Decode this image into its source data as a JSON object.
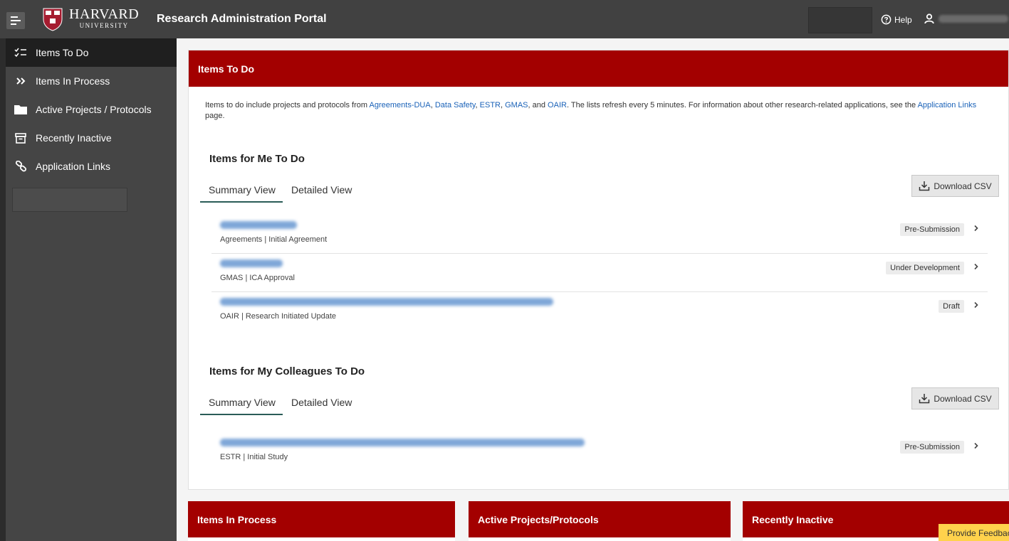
{
  "header": {
    "brand_name": "HARVARD",
    "brand_sub": "UNIVERSITY",
    "portal_title": "Research Administration Portal",
    "help_label": "Help"
  },
  "sidebar": {
    "items": [
      {
        "label": "Items To Do",
        "icon": "checklist-icon"
      },
      {
        "label": "Items In Process",
        "icon": "double-chevron-icon"
      },
      {
        "label": "Active Projects / Protocols",
        "icon": "folder-icon"
      },
      {
        "label": "Recently Inactive",
        "icon": "archive-icon"
      },
      {
        "label": "Application Links",
        "icon": "link-icon"
      }
    ]
  },
  "main": {
    "card_title": "Items To Do",
    "intro": {
      "p1": "Items to do include projects and protocols from ",
      "l1": "Agreements-DUA",
      "s1": ", ",
      "l2": "Data Safety",
      "s2": ", ",
      "l3": "ESTR",
      "s3": ", ",
      "l4": "GMAS",
      "s4": ", and ",
      "l5": "OAIR",
      "p2": ". The lists refresh every 5 minutes. For information about other research-related applications, see the ",
      "l6": "Application Links",
      "p3": " page."
    },
    "me": {
      "title": "Items for Me To Do",
      "tab_summary": "Summary View",
      "tab_detailed": "Detailed View",
      "download": "Download CSV",
      "rows": [
        {
          "meta": "Agreements | Initial Agreement",
          "status": "Pre-Submission"
        },
        {
          "meta": "GMAS | ICA Approval",
          "status": "Under Development"
        },
        {
          "meta": "OAIR | Research Initiated Update",
          "status": "Draft"
        }
      ]
    },
    "colleagues": {
      "title": "Items for My Colleagues To Do",
      "tab_summary": "Summary View",
      "tab_detailed": "Detailed View",
      "download": "Download CSV",
      "rows": [
        {
          "meta": "ESTR | Initial Study",
          "status": "Pre-Submission"
        }
      ]
    }
  },
  "bottom_cards": {
    "in_process": "Items In Process",
    "active": "Active Projects/Protocols",
    "inactive": "Recently Inactive"
  },
  "feedback_label": "Provide Feedback",
  "colors": {
    "accent": "#a30000",
    "topbar": "#414141",
    "sidebar": "#454545",
    "link": "#1a62b8",
    "feedback": "#ffd24c"
  }
}
